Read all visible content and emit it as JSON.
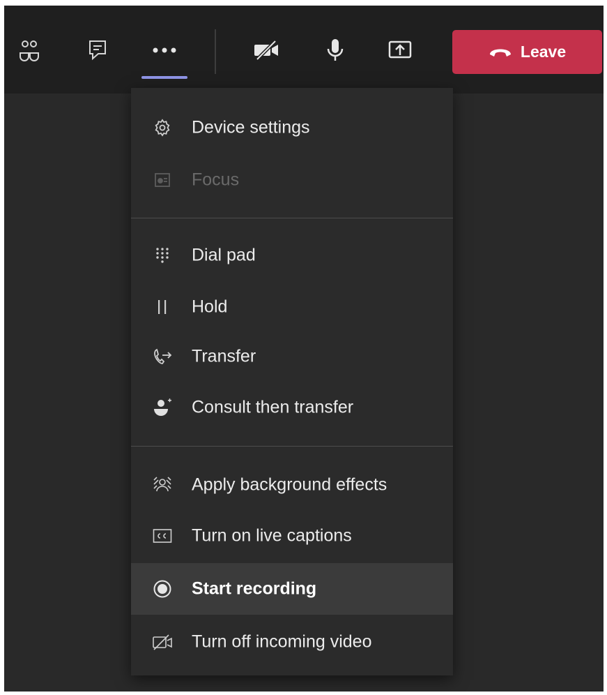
{
  "toolbar": {
    "buttons": [
      {
        "name": "participants-icon"
      },
      {
        "name": "chat-icon"
      },
      {
        "name": "more-actions-icon"
      },
      {
        "name": "camera-off-icon"
      },
      {
        "name": "microphone-icon"
      },
      {
        "name": "share-screen-icon"
      }
    ],
    "leave_label": "Leave",
    "leave_color": "#c4314b",
    "active_indicator_color": "#8f94e6"
  },
  "menu": {
    "sections": [
      {
        "items": [
          {
            "label": "Device settings",
            "icon": "gear-icon",
            "state": "normal"
          },
          {
            "label": "Focus",
            "icon": "focus-icon",
            "state": "disabled"
          }
        ]
      },
      {
        "items": [
          {
            "label": "Dial pad",
            "icon": "dialpad-icon",
            "state": "normal"
          },
          {
            "label": "Hold",
            "icon": "pause-icon",
            "state": "normal"
          },
          {
            "label": "Transfer",
            "icon": "transfer-call-icon",
            "state": "normal"
          },
          {
            "label": "Consult then transfer",
            "icon": "consult-transfer-icon",
            "state": "normal"
          }
        ]
      },
      {
        "items": [
          {
            "label": "Apply background effects",
            "icon": "background-effects-icon",
            "state": "normal"
          },
          {
            "label": "Turn on live captions",
            "icon": "captions-icon",
            "state": "normal"
          },
          {
            "label": "Start recording",
            "icon": "record-icon",
            "state": "hovered"
          },
          {
            "label": "Turn off incoming video",
            "icon": "video-off-icon",
            "state": "normal"
          }
        ]
      }
    ]
  }
}
